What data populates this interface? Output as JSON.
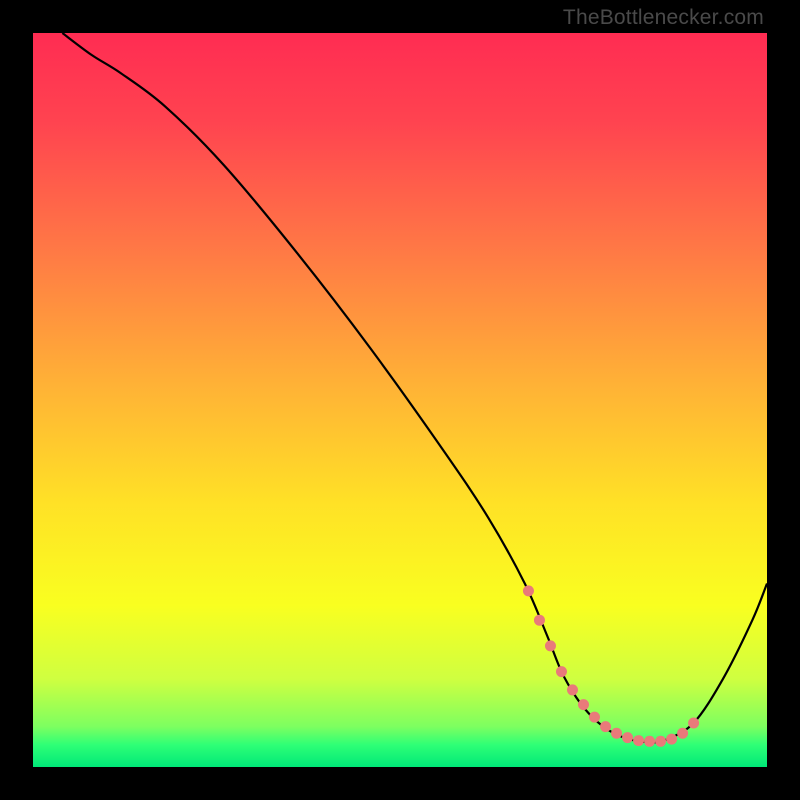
{
  "watermark": "TheBottleneсker.com",
  "chart_data": {
    "type": "line",
    "title": "",
    "xlabel": "",
    "ylabel": "",
    "xlim": [
      0,
      100
    ],
    "ylim": [
      0,
      100
    ],
    "grid": false,
    "gradient": {
      "stops": [
        {
          "offset": 0.0,
          "color": "#ff2c52"
        },
        {
          "offset": 0.12,
          "color": "#ff4350"
        },
        {
          "offset": 0.3,
          "color": "#ff7a45"
        },
        {
          "offset": 0.48,
          "color": "#ffb236"
        },
        {
          "offset": 0.64,
          "color": "#ffe126"
        },
        {
          "offset": 0.78,
          "color": "#f9ff20"
        },
        {
          "offset": 0.88,
          "color": "#cfff40"
        },
        {
          "offset": 0.945,
          "color": "#7dff60"
        },
        {
          "offset": 0.97,
          "color": "#2eff76"
        },
        {
          "offset": 1.0,
          "color": "#00e878"
        }
      ]
    },
    "series": [
      {
        "name": "bottleneck-curve",
        "stroke": "#000000",
        "width": 2.2,
        "x": [
          4,
          8,
          12,
          18,
          26,
          36,
          46,
          56,
          62,
          67,
          70,
          72,
          74,
          76,
          78,
          80,
          82,
          84,
          86,
          90,
          94,
          98,
          100
        ],
        "y": [
          100,
          97,
          94.5,
          90,
          82,
          70,
          57,
          43,
          34,
          25,
          18,
          13,
          9.5,
          7,
          5.3,
          4.2,
          3.6,
          3.4,
          3.6,
          6,
          12,
          20,
          25
        ]
      }
    ],
    "markers": {
      "name": "highlight-dots",
      "color": "#e97a7a",
      "radius": 5.5,
      "x": [
        67.5,
        69,
        70.5,
        72,
        73.5,
        75,
        76.5,
        78,
        79.5,
        81,
        82.5,
        84,
        85.5,
        87,
        88.5,
        90
      ],
      "y": [
        24,
        20,
        16.5,
        13,
        10.5,
        8.5,
        6.8,
        5.5,
        4.6,
        4.0,
        3.6,
        3.5,
        3.5,
        3.8,
        4.6,
        6.0
      ]
    }
  }
}
